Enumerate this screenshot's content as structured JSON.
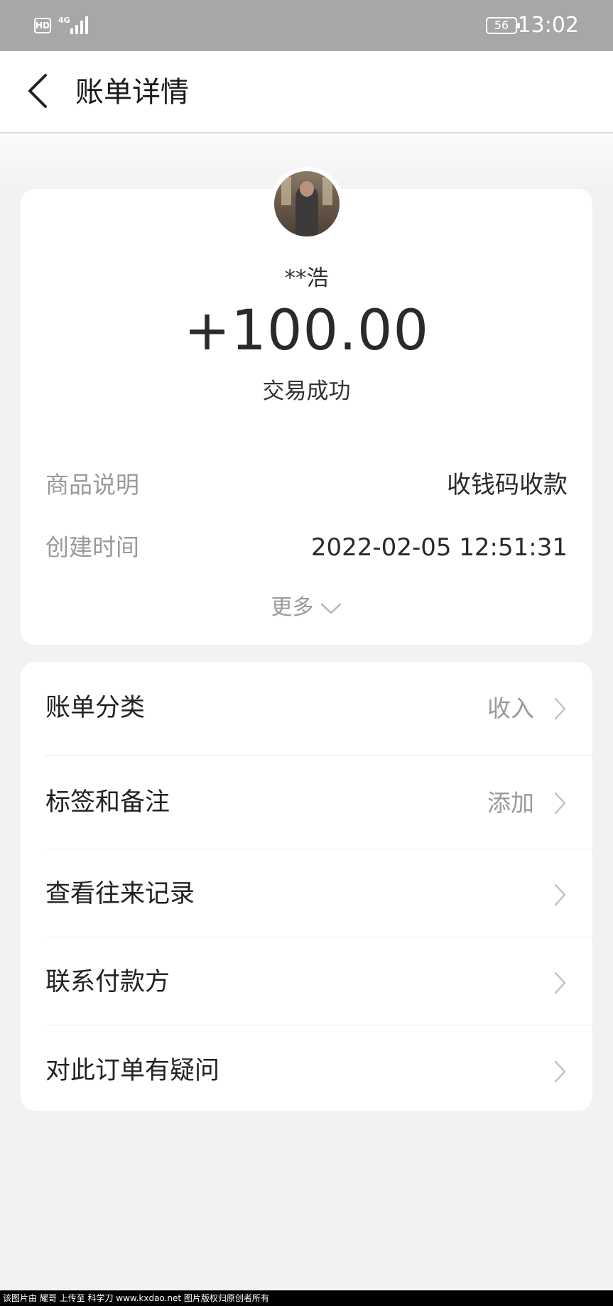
{
  "status_bar": {
    "hd": "HD",
    "network": "4G",
    "battery": "56",
    "time": "13:02"
  },
  "header": {
    "title": "账单详情"
  },
  "transaction": {
    "payer": "**浩",
    "amount": "+100.00",
    "status": "交易成功"
  },
  "details": [
    {
      "label": "商品说明",
      "value": "收钱码收款"
    },
    {
      "label": "创建时间",
      "value": "2022-02-05 12:51:31"
    }
  ],
  "more_label": "更多",
  "menu": [
    {
      "label": "账单分类",
      "value": "收入"
    },
    {
      "label": "标签和备注",
      "value": "添加"
    },
    {
      "label": "查看往来记录",
      "value": ""
    },
    {
      "label": "联系付款方",
      "value": ""
    },
    {
      "label": "对此订单有疑问",
      "value": ""
    }
  ],
  "watermark": "该图片由 耀哥 上传至 科学刀 www.kxdao.net 图片版权归原创者所有"
}
